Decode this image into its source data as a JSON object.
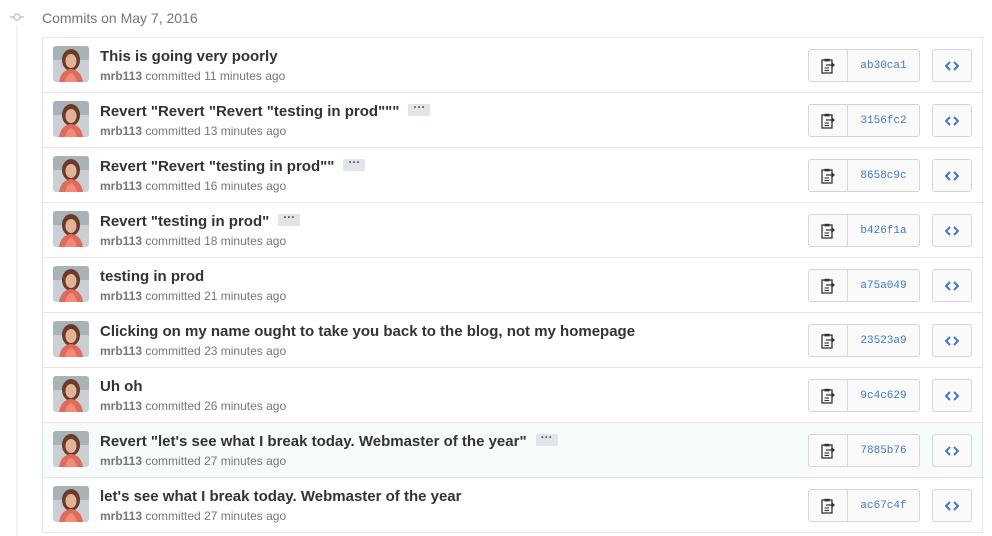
{
  "group": {
    "title": "Commits on May 7, 2016"
  },
  "labels": {
    "committed": "committed",
    "ellipsis": "···",
    "browse": "<>"
  },
  "colors": {
    "link": "#4078c0",
    "highlight_row": "#f7fbfc"
  },
  "commits": [
    {
      "title": "This is going very poorly",
      "author": "mrb113",
      "time": "11 minutes ago",
      "sha": "ab30ca1",
      "has_ellipsis": false,
      "highlighted": false
    },
    {
      "title": "Revert \"Revert \"Revert \"testing in prod\"\"\"",
      "author": "mrb113",
      "time": "13 minutes ago",
      "sha": "3156fc2",
      "has_ellipsis": true,
      "highlighted": false
    },
    {
      "title": "Revert \"Revert \"testing in prod\"\"",
      "author": "mrb113",
      "time": "16 minutes ago",
      "sha": "8658c9c",
      "has_ellipsis": true,
      "highlighted": false
    },
    {
      "title": "Revert \"testing in prod\"",
      "author": "mrb113",
      "time": "18 minutes ago",
      "sha": "b426f1a",
      "has_ellipsis": true,
      "highlighted": false
    },
    {
      "title": "testing in prod",
      "author": "mrb113",
      "time": "21 minutes ago",
      "sha": "a75a049",
      "has_ellipsis": false,
      "highlighted": false
    },
    {
      "title": "Clicking on my name ought to take you back to the blog, not my homepage",
      "author": "mrb113",
      "time": "23 minutes ago",
      "sha": "23523a9",
      "has_ellipsis": false,
      "highlighted": false
    },
    {
      "title": "Uh oh",
      "author": "mrb113",
      "time": "26 minutes ago",
      "sha": "9c4c629",
      "has_ellipsis": false,
      "highlighted": false
    },
    {
      "title": "Revert \"let's see what I break today. Webmaster of the year\"",
      "author": "mrb113",
      "time": "27 minutes ago",
      "sha": "7885b76",
      "has_ellipsis": true,
      "highlighted": true
    },
    {
      "title": "let's see what I break today. Webmaster of the year",
      "author": "mrb113",
      "time": "27 minutes ago",
      "sha": "ac67c4f",
      "has_ellipsis": false,
      "highlighted": false
    }
  ]
}
